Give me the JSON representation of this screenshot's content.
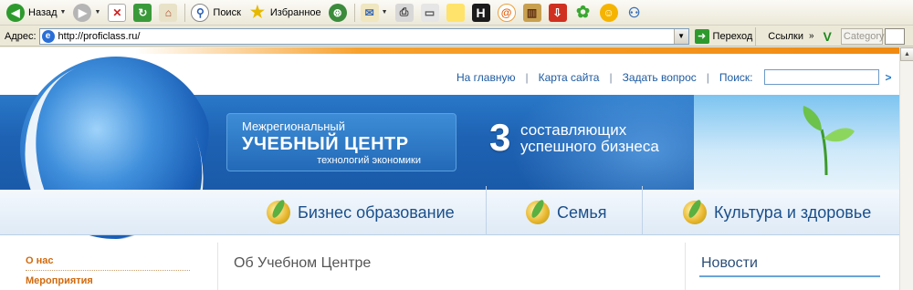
{
  "browser": {
    "toolbar": {
      "back_label": "Назад",
      "search_label": "Поиск",
      "favorites_label": "Избранное"
    },
    "address": {
      "label": "Адрес:",
      "url": "http://proficlass.ru/",
      "go_label": "Переход",
      "links_label": "Ссылки",
      "category_placeholder": "Category"
    }
  },
  "site": {
    "topnav": {
      "home": "На главную",
      "sitemap": "Карта сайта",
      "ask": "Задать вопрос",
      "search_label": "Поиск:"
    },
    "brand": {
      "line1": "Межрегиональный",
      "line2": "УЧЕБНЫЙ ЦЕНТР",
      "line3": "технологий экономики"
    },
    "promo": {
      "number": "3",
      "line1": "составляющих",
      "line2": "успешного бизнеса"
    },
    "menu": [
      "Бизнес образование",
      "Семья",
      "Культура и здоровье"
    ],
    "sidebar": [
      "О нас",
      "Мероприятия"
    ],
    "center_title": "Об Учебном Центре",
    "news_title": "Новости"
  },
  "colors": {
    "brand_blue": "#1e62b4",
    "accent_orange": "#f08a10",
    "link_blue": "#1d5aa0"
  }
}
